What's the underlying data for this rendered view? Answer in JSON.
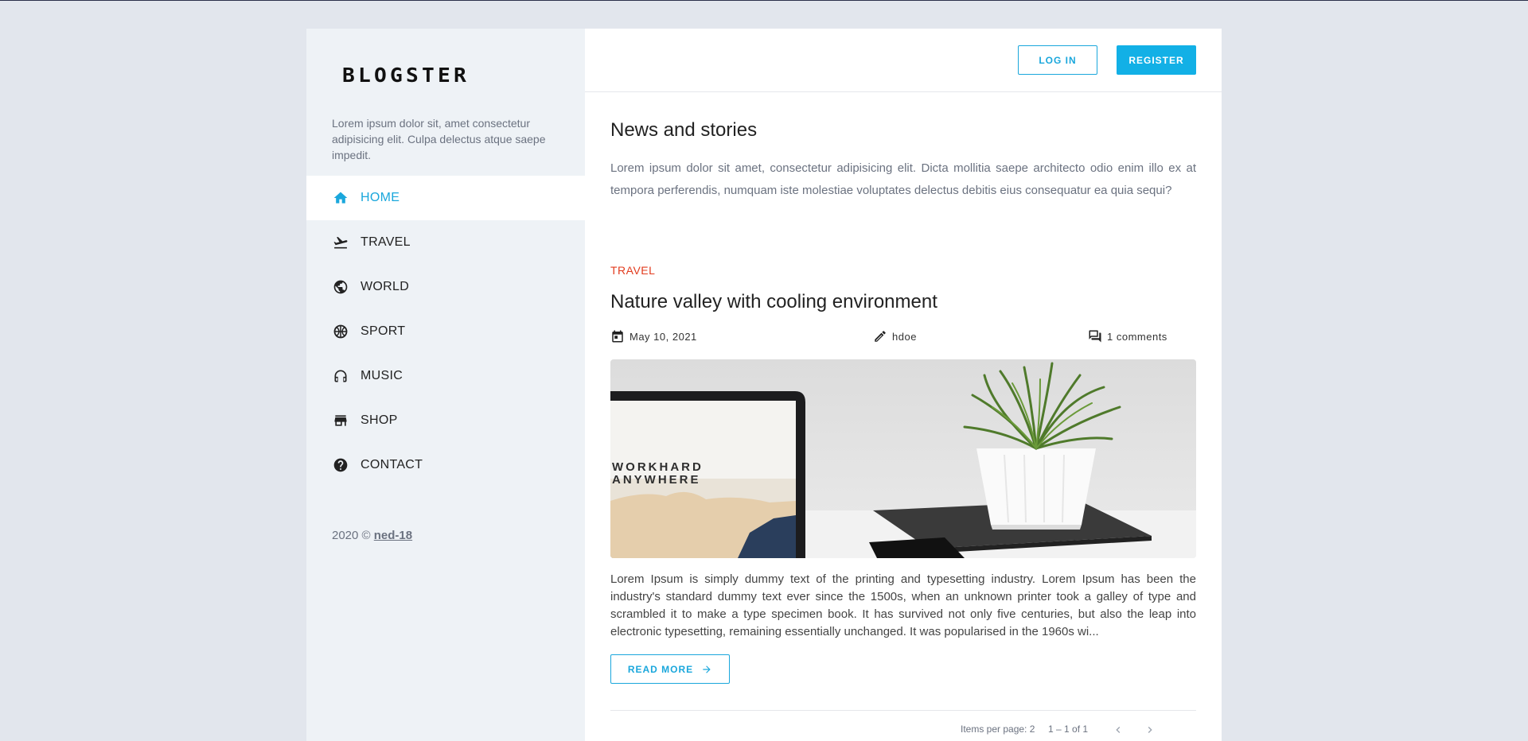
{
  "sidebar": {
    "logo": "BLOGSTER",
    "tagline": "Lorem ipsum dolor sit, amet consectetur adipisicing elit. Culpa delectus atque saepe impedit.",
    "nav": [
      {
        "label": "HOME",
        "icon": "home-icon",
        "active": true
      },
      {
        "label": "TRAVEL",
        "icon": "flight-takeoff-icon",
        "active": false
      },
      {
        "label": "WORLD",
        "icon": "globe-icon",
        "active": false
      },
      {
        "label": "SPORT",
        "icon": "sports-basketball-icon",
        "active": false
      },
      {
        "label": "MUSIC",
        "icon": "headphones-icon",
        "active": false
      },
      {
        "label": "SHOP",
        "icon": "store-icon",
        "active": false
      },
      {
        "label": "CONTACT",
        "icon": "help-icon",
        "active": false
      }
    ],
    "copyright_prefix": "2020 ©",
    "copyright_link": "ned-18"
  },
  "header": {
    "login_label": "LOG IN",
    "register_label": "REGISTER"
  },
  "main": {
    "title": "News and stories",
    "intro": "Lorem ipsum dolor sit amet, consectetur adipisicing elit. Dicta mollitia saepe architecto odio enim illo ex at tempora perferendis, numquam iste molestiae voluptates delectus debitis eius consequatur ea quia sequi?"
  },
  "post": {
    "category": "TRAVEL",
    "title": "Nature valley with cooling environment",
    "date": "May 10, 2021",
    "author": "hdoe",
    "comments": "1 comments",
    "image_text_line1": "WORKHARD",
    "image_text_line2": "ANYWHERE",
    "excerpt": "Lorem Ipsum is simply dummy text of the printing and typesetting industry. Lorem Ipsum has been the industry's standard dummy text ever since the 1500s, when an unknown printer took a galley of type and scrambled it to make a type specimen book. It has survived not only five centuries, but also the leap into electronic typesetting, remaining essentially unchanged. It was popularised in the 1960s wi...",
    "read_more_label": "READ MORE"
  },
  "pagination": {
    "items_per_page_label": "Items per page:",
    "items_per_page_value": "2",
    "range": "1 – 1 of 1"
  },
  "colors": {
    "accent": "#1aa7dc",
    "category": "#e23b1e",
    "sidebar_bg": "#eef2f6",
    "page_bg": "#e2e6ed"
  }
}
